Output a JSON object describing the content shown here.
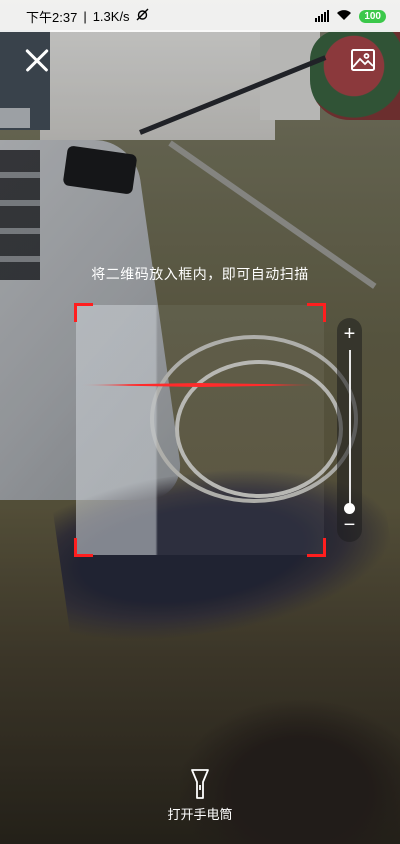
{
  "status_bar": {
    "time": "下午2:37",
    "speed": "1.3K/s",
    "battery": "100"
  },
  "scanner": {
    "hint": "将二维码放入框内，即可自动扫描",
    "scan_line_color": "#ff2b2b",
    "corner_color": "#ff1e1e"
  },
  "zoom": {
    "plus_label": "+",
    "minus_label": "−",
    "level": 0.0
  },
  "flashlight": {
    "label": "打开手电筒"
  },
  "icons": {
    "close": "close-icon",
    "gallery": "image-icon",
    "flashlight": "flashlight-icon"
  }
}
